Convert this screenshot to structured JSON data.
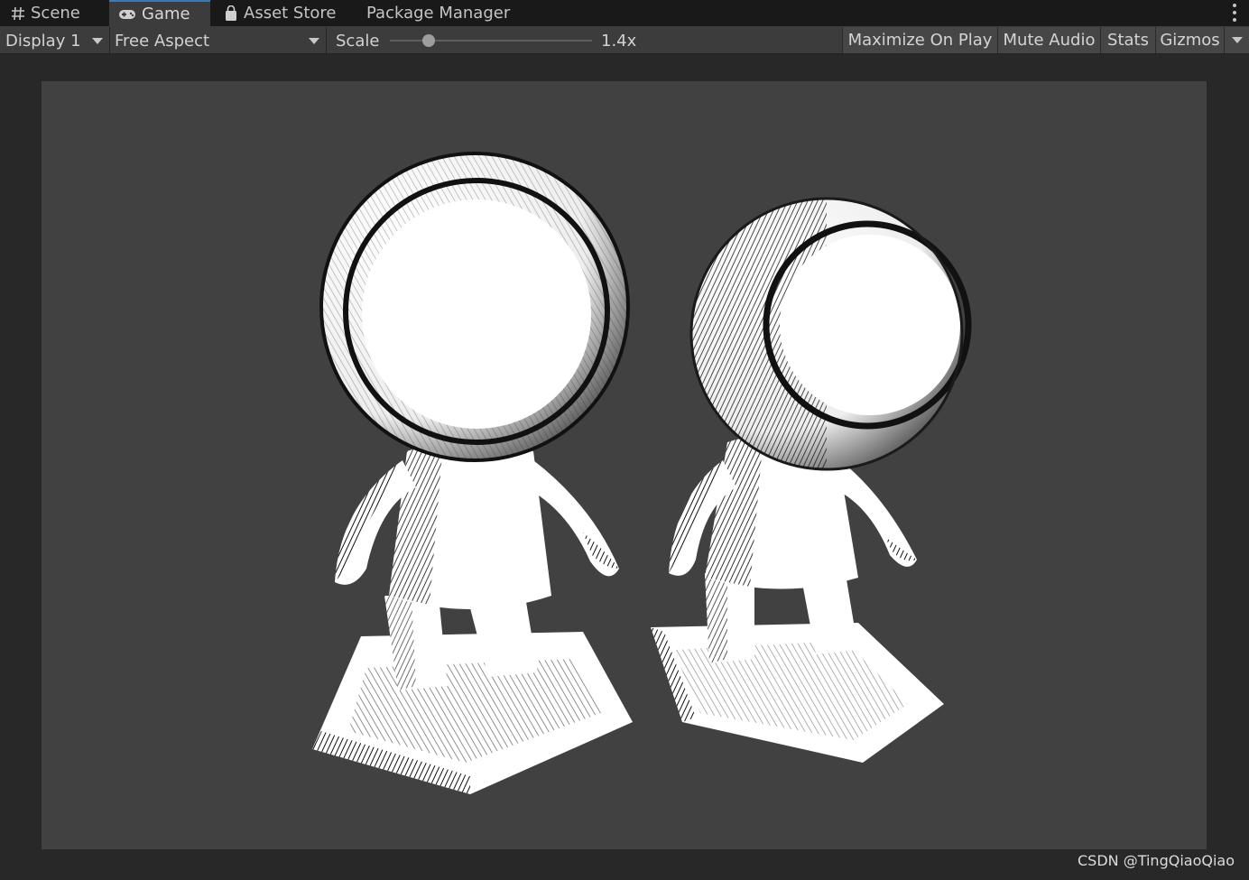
{
  "tabs": [
    {
      "label": "Scene",
      "icon": "hash-icon",
      "active": false
    },
    {
      "label": "Game",
      "icon": "gamepad-icon",
      "active": true
    },
    {
      "label": "Asset Store",
      "icon": "bag-icon",
      "active": false
    },
    {
      "label": "Package Manager",
      "icon": "",
      "active": false
    }
  ],
  "toolbar": {
    "display": "Display 1",
    "aspect": "Free Aspect",
    "scale_label": "Scale",
    "scale_value": "1.4x",
    "scale_fraction": 0.19,
    "maximize": "Maximize On Play",
    "mute": "Mute Audio",
    "stats": "Stats",
    "gizmos": "Gizmos"
  },
  "watermark": "CSDN @TingQiaoQiao",
  "colors": {
    "tab_accent": "#3a79bb",
    "viewport_bg": "#414141"
  }
}
